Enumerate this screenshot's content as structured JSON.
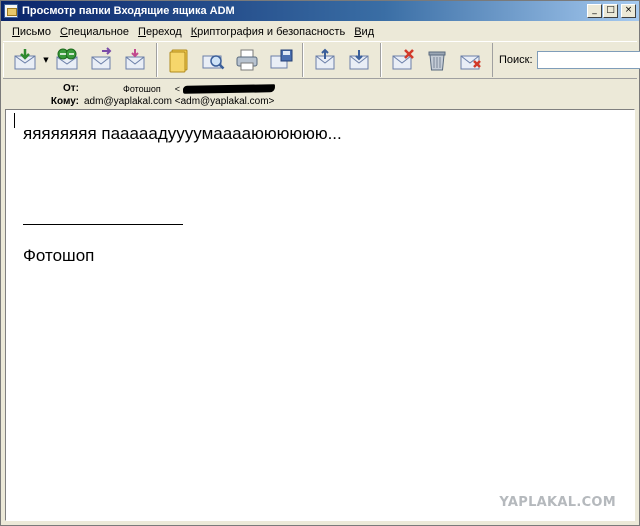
{
  "window": {
    "title": "Просмотр папки Входящие ящика ADM",
    "buttons": {
      "minimize": "_",
      "maximize": "□",
      "close": "×"
    }
  },
  "menu": [
    "Письмо",
    "Специальное",
    "Переход",
    "Криптография и безопасность",
    "Вид"
  ],
  "toolbar": {
    "groups": [
      [
        "get-mail-icon",
        "reply-icon",
        "forward-icon",
        "new-message-icon"
      ],
      [
        "address-book-icon",
        "find-message-icon",
        "print-icon",
        "save-icon"
      ],
      [
        "previous-message-icon",
        "next-message-icon"
      ],
      [
        "delete-icon",
        "trash-icon",
        "mark-junk-icon"
      ]
    ],
    "search_label": "Поиск:",
    "search_value": ""
  },
  "header": {
    "from_label": "От:",
    "from_name": "Фотошоп",
    "from_email_prefix": "<",
    "to_label": "Кому:",
    "to_value": "adm@yaplakal.com <adm@yaplakal.com>"
  },
  "message": {
    "line1": "яяяяяяяя пааааадуууумааааюююююю...",
    "signature": "Фотошоп"
  },
  "watermark": "YAPLAKAL.COM"
}
